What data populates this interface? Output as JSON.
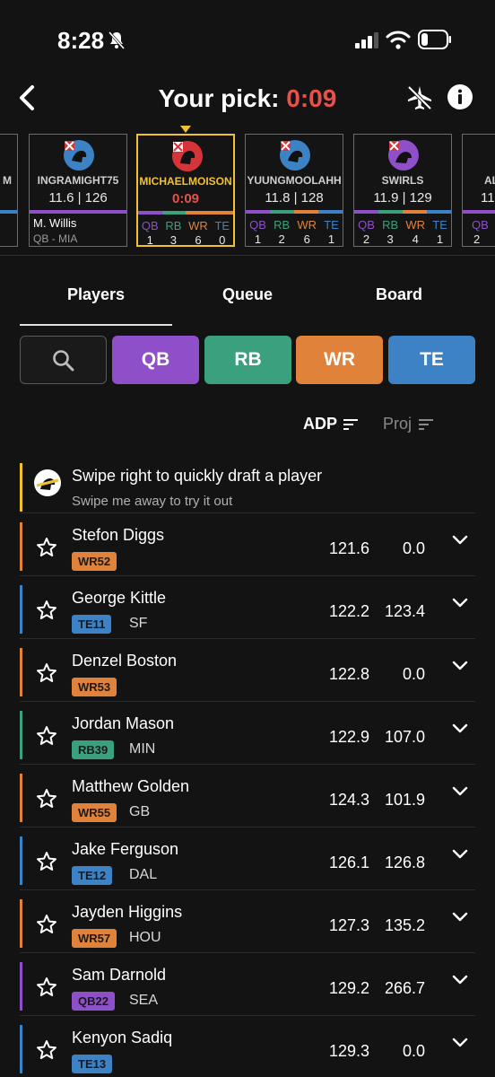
{
  "status_bar": {
    "time": "8:28"
  },
  "header": {
    "title_prefix": "Your pick: ",
    "timer": "0:09"
  },
  "draft_board": {
    "left_partial_letter": "M",
    "right_partial_letters": "AL",
    "right_partial_meta": "11.",
    "right_partial_count": "2",
    "cards": [
      {
        "name": "INGRAMIGHT75",
        "meta": "11.6 | 126",
        "pick_line1": "M. Willis",
        "pick_line2": "QB - MIA"
      },
      {
        "name": "MICHAELMOISON",
        "meta": "0:09",
        "pos_labels": [
          "QB",
          "RB",
          "WR",
          "TE"
        ],
        "pos_counts": [
          "1",
          "3",
          "6",
          "0"
        ]
      },
      {
        "name": "YUUNGMOOLAHH",
        "meta": "11.8 | 128",
        "pos_labels": [
          "QB",
          "RB",
          "WR",
          "TE"
        ],
        "pos_counts": [
          "1",
          "2",
          "6",
          "1"
        ]
      },
      {
        "name": "SWIRLS",
        "meta": "11.9 | 129",
        "pos_labels": [
          "QB",
          "RB",
          "WR",
          "TE"
        ],
        "pos_counts": [
          "2",
          "3",
          "4",
          "1"
        ]
      }
    ]
  },
  "tabs": [
    "Players",
    "Queue",
    "Board"
  ],
  "filters": [
    "QB",
    "RB",
    "WR",
    "TE"
  ],
  "sort": {
    "adp": "ADP",
    "proj": "Proj"
  },
  "tip": {
    "title": "Swipe right to quickly draft a player",
    "subtitle": "Swipe me away to try it out"
  },
  "colors": {
    "qb": "#8e4fc9",
    "rb": "#3aa07e",
    "wr": "#e0823a",
    "te": "#3c82c4",
    "accent": "#f2c22c",
    "timer": "#e8504a"
  },
  "players": [
    {
      "name": "Stefon Diggs",
      "pos": "wr",
      "badge": "WR52",
      "team": "",
      "adp": "121.6",
      "proj": "0.0"
    },
    {
      "name": "George Kittle",
      "pos": "te",
      "badge": "TE11",
      "team": "SF",
      "adp": "122.2",
      "proj": "123.4"
    },
    {
      "name": "Denzel Boston",
      "pos": "wr",
      "badge": "WR53",
      "team": "",
      "adp": "122.8",
      "proj": "0.0"
    },
    {
      "name": "Jordan Mason",
      "pos": "rb",
      "badge": "RB39",
      "team": "MIN",
      "adp": "122.9",
      "proj": "107.0"
    },
    {
      "name": "Matthew Golden",
      "pos": "wr",
      "badge": "WR55",
      "team": "GB",
      "adp": "124.3",
      "proj": "101.9"
    },
    {
      "name": "Jake Ferguson",
      "pos": "te",
      "badge": "TE12",
      "team": "DAL",
      "adp": "126.1",
      "proj": "126.8"
    },
    {
      "name": "Jayden Higgins",
      "pos": "wr",
      "badge": "WR57",
      "team": "HOU",
      "adp": "127.3",
      "proj": "135.2"
    },
    {
      "name": "Sam Darnold",
      "pos": "qb",
      "badge": "QB22",
      "team": "SEA",
      "adp": "129.2",
      "proj": "266.7"
    },
    {
      "name": "Kenyon Sadiq",
      "pos": "te",
      "badge": "TE13",
      "team": "",
      "adp": "129.3",
      "proj": "0.0"
    }
  ]
}
